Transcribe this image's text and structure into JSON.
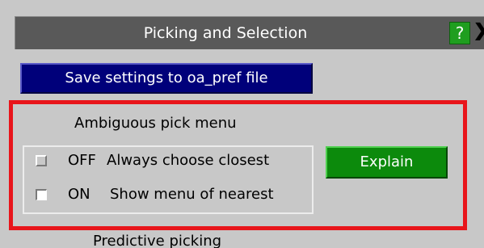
{
  "window": {
    "title": "Picking and Selection",
    "help_label": "?",
    "close_label": "X"
  },
  "toolbar": {
    "save_label": "Save settings to oa_pref file"
  },
  "ambiguous_pick": {
    "section_label": "Ambiguous pick menu",
    "options": [
      {
        "state": "OFF",
        "text": "Always choose closest",
        "checked": false
      },
      {
        "state": "ON",
        "text": "Show menu of nearest",
        "checked": true
      }
    ],
    "explain_label": "Explain"
  },
  "predictive": {
    "section_label": "Predictive picking"
  },
  "colors": {
    "titlebar": "#595959",
    "save_button": "#00007a",
    "explain_button": "#0c8a0c",
    "help_button": "#1f9e1f",
    "highlight": "#e8151b",
    "panel_background": "#c8c8c8"
  }
}
